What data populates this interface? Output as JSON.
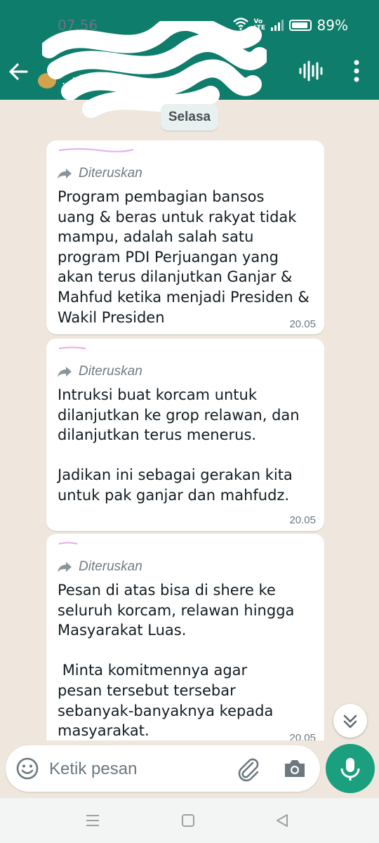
{
  "status_bar": {
    "time": "07.56",
    "battery": "89%",
    "network": "Vo LTE"
  },
  "chat_header": {
    "contact_name": "...pk, I"
  },
  "date_chip": "Selasa",
  "messages": [
    {
      "forwarded_label": "Diteruskan",
      "text": "Program pembagian bansos\nuang & beras untuk rakyat tidak\nmampu, adalah salah satu\nprogram PDI Perjuangan yang\nakan terus dilanjutkan Ganjar &\nMahfud ketika menjadi Presiden &\nWakil Presiden",
      "time": "20.05"
    },
    {
      "forwarded_label": "Diteruskan",
      "text": "Intruksi buat korcam untuk\ndilanjutkan ke grop relawan, dan\ndilanjutkan terus menerus.\n\nJadikan ini sebagai gerakan kita\nuntuk pak ganjar dan mahfudz.",
      "time": "20.05"
    },
    {
      "forwarded_label": "Diteruskan",
      "text": "Pesan di atas bisa di shere ke\nseluruh korcam, relawan hingga\nMasyarakat Luas.\n\n Minta komitmennya agar\npesan tersebut tersebar\nsebanyak-banyaknya kepada\nmasyarakat.",
      "time": "20.05"
    }
  ],
  "composer": {
    "placeholder": "Ketik pesan"
  },
  "colors": {
    "header": "#0f7d6b",
    "chat_background": "#efe7dd",
    "mic_button": "#1aa07f"
  }
}
